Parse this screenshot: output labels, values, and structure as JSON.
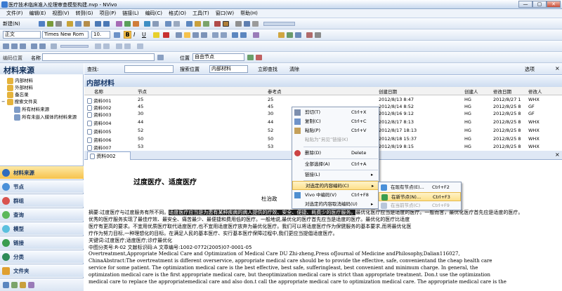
{
  "window": {
    "title": "医疗技术临床准入伦理审查模型构建.nvp - NVivo",
    "min": "—",
    "max": "▢",
    "close": "✕"
  },
  "menu": [
    "文件(F)",
    "编辑(E)",
    "视图(V)",
    "转到(G)",
    "项目(P)",
    "链接(L)",
    "编码(C)",
    "格式(O)",
    "工具(T)",
    "窗口(W)",
    "帮助(H)"
  ],
  "toolbar1": {
    "new_label": "新建(N)"
  },
  "toolbar2": {
    "style": "正文",
    "font": "Times New Rom",
    "size": "10.",
    "bold": "B",
    "italic": "I",
    "underline": "U"
  },
  "toolbar4": {
    "code_at": "编码位置",
    "name_label": "名称",
    "node_value": "",
    "in_label": "位置",
    "in_value": "自由节点"
  },
  "left": {
    "title": "材料来源",
    "tree": [
      "内部材料",
      "外部材料",
      "备忘录",
      "搜索文件夹",
      "所有材料来源",
      "所有未嵌入媒体的材料来源"
    ],
    "nav": [
      "材料来源",
      "节点",
      "群组",
      "查询",
      "模型",
      "链接",
      "分类",
      "文件夹"
    ]
  },
  "findbar": {
    "find_label": "查找:",
    "find_value": "",
    "search_in_label": "搜索位置",
    "search_in_value": "内部材料",
    "find_now": "立即查找",
    "clear": "清除",
    "options": "选项"
  },
  "list": {
    "title": "内部材料",
    "columns": [
      "名称",
      "节点",
      "参考点",
      "创建日期",
      "创建人",
      "修改日期",
      "修改人"
    ],
    "rows": [
      [
        "资料001",
        "25",
        "25",
        "2012/8/13 8:47",
        "HG",
        "2012/8/27 1",
        "WHX"
      ],
      [
        "资料002",
        "45",
        "45",
        "2012/8/14 8:52",
        "HG",
        "2012/8/25 8",
        "GF"
      ],
      [
        "资料003",
        "30",
        "30",
        "2012/8/16 9:12",
        "HG",
        "2012/8/25 8",
        "GF"
      ],
      [
        "资料004",
        "44",
        "44",
        "2012/8/17 8:13",
        "HG",
        "2012/8/25 8",
        "WHX"
      ],
      [
        "资料005",
        "52",
        "52",
        "2012/8/17 18:13",
        "HG",
        "2012/8/25 8",
        "WHX"
      ],
      [
        "资料006",
        "50",
        "50",
        "2012/8/18 15:37",
        "HG",
        "2012/8/25 8",
        "WHX"
      ],
      [
        "资料007",
        "53",
        "53",
        "2012/8/19 8:15",
        "HG",
        "2012/8/25 8",
        "WHX"
      ]
    ]
  },
  "doc_tab": "资料002",
  "doc": {
    "title": "过度医疗、适度医疗",
    "author": "杜治政",
    "abstract_lead": "摘要:过度医疗与过度服务有所不同。",
    "abstract_sel": "适度医疗应当是为患有某种疾病的病人提供的疗效、安全、便捷、耗费少的医疗服务。",
    "abstract_rest": "最优化医疗应当是适度的医疗。一般而言，最优化医疗首先应是适度的医疗。",
    "lines": [
      "优秀的医疗服务实现了最佳疗效、最安全、痛苦最少、最便捷和费用低的医疗。一般地说,最优化的医疗首先应当是适度的医疗。最优化的医疗比适度",
      "医疗有更高的要求。不宜用优质医疗取代适度医疗,也不宜用适度医疗放弃为最优化医疗。我们可以将适度医疗作为保健服务的基本要求,而将最优化医",
      "疗作为努力目标,一种理想化的目标。在满足人民的基本医疗、实行基本医疗保障过程中,我们更应当提倡适度医疗。",
      "关键词:过度医疗;适度医疗;诊疗最优化",
      "中图分类号:R-02 文献标识码:A 文章编号:1002-0772(2005)07-0001-05",
      "Overtreatment,Appropriate Medical Care and Optimization of Medical Care DU Zhi-zheng,Press ofJournal of Medicine andPhilosophy,Dalian116027,",
      "ChinaAbstract:The overtreatment is different overservice, appropriate medical care should be to provide the effective, safe, convenientand the cheap health care",
      "service for some patient. The optimization medical care is the best effective, best safe, sufferingleast, best convenient and minimum charge. In general, the",
      "optimization medical care is the first appropriate medical care, but theoptimization medical care is strict than appropriate treatment. Don.t use the optimization",
      "medical care to replace the appropriatemedical care and also don.t call the appropriate medical care to optimization medical care. The appropriate medical care is the"
    ]
  },
  "context_menu": [
    {
      "label": "剪切(T)",
      "key": "Ctrl+X",
      "icon": "cut-icon"
    },
    {
      "label": "复制(C)",
      "key": "Ctrl+C",
      "icon": "copy-icon"
    },
    {
      "label": "粘贴(P)",
      "key": "Ctrl+V",
      "icon": "paste-icon"
    },
    {
      "label": "粘贴为“另见”链接(K)",
      "key": "",
      "icon": ""
    },
    {
      "label": "删除(D)",
      "key": "Delete",
      "icon": "delete-icon"
    },
    {
      "label": "全部选择(A)",
      "key": "Ctrl+A",
      "icon": ""
    },
    {
      "label": "链接(L)",
      "key": "",
      "icon": ""
    },
    {
      "label": "对选定的内容编码(C)",
      "key": "",
      "icon": ""
    },
    {
      "label": "Vivo 中编码(V)",
      "key": "Ctrl+F8",
      "icon": "vivo-icon"
    },
    {
      "label": "对选定的内容取消编码(U)",
      "key": "",
      "icon": ""
    }
  ],
  "submenu": [
    {
      "label": "在现有节点(E)...",
      "key": "Ctrl+F2"
    },
    {
      "label": "在新节点(N)...",
      "key": "Ctrl+F3"
    },
    {
      "label": "在当前节点(C)",
      "key": "Ctrl+F9"
    }
  ],
  "colors": {
    "accent": "#f6c24c",
    "chrome": "#dbe6f4",
    "title": "#1a3a6b"
  }
}
